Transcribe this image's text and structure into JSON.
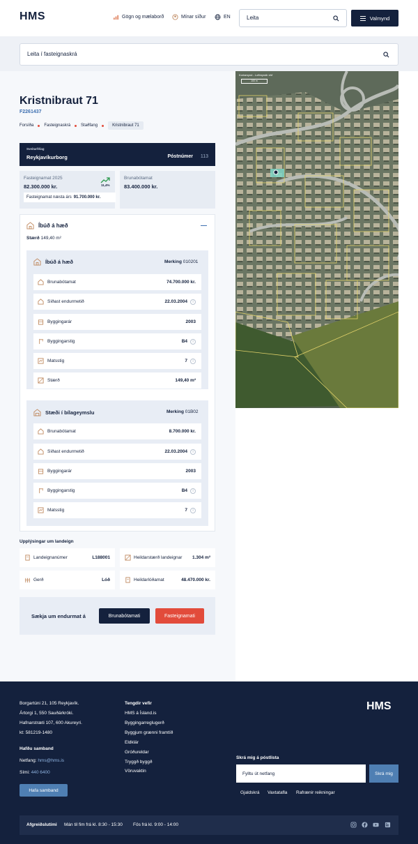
{
  "header": {
    "logo": "HMS",
    "nav": [
      {
        "label": "Gögn og mælaborð",
        "icon": "chart-icon"
      },
      {
        "label": "Mínar síður",
        "icon": "user-circle-icon"
      },
      {
        "label": "EN",
        "icon": "globe-icon"
      }
    ],
    "search_placeholder": "Leita",
    "menu_label": "Valmynd"
  },
  "registry_search": {
    "placeholder": "Leita í fasteignaskrá"
  },
  "property": {
    "title": "Kristnibraut 71",
    "id": "F2261437",
    "breadcrumbs": [
      "Forsíða",
      "Fasteignaskrá",
      "Staðfang",
      "Kristnibraut 71"
    ],
    "municipality_label": "Sveitarfélag",
    "municipality": "Reykjavíkurborg",
    "postcode_label": "Póstnúmer",
    "postcode": "113",
    "valuation": {
      "label": "Fasteignamat 2025",
      "value": "82.300.000 kr.",
      "change": "11,4%",
      "next_label": "Fasteignamat næsta árs",
      "next_value": "91.700.000 kr."
    },
    "fire_valuation": {
      "label": "Brunabótamat",
      "value": "83.400.000 kr."
    }
  },
  "unit": {
    "title": "Íbúð á hæð",
    "size_label": "Stærð",
    "size": "149,40 m²",
    "subunits": [
      {
        "title": "Íbúð á hæð",
        "mark_label": "Merking",
        "mark": "010201",
        "rows": [
          {
            "label": "Brunabótamat",
            "value": "74.700.000 kr.",
            "info": false
          },
          {
            "label": "Síðast endurmetið",
            "value": "22.03.2004",
            "info": true
          },
          {
            "label": "Byggingarár",
            "value": "2003",
            "info": false
          },
          {
            "label": "Byggingarstig",
            "value": "B4",
            "info": true
          },
          {
            "label": "Matsstig",
            "value": "7",
            "info": true
          },
          {
            "label": "Stærð",
            "value": "149,40 m²",
            "info": false
          }
        ]
      },
      {
        "title": "Stæði í bílageymslu",
        "mark_label": "Merking",
        "mark": "01B02",
        "rows": [
          {
            "label": "Brunabótamat",
            "value": "8.700.000 kr.",
            "info": false
          },
          {
            "label": "Síðast endurmetið",
            "value": "22.03.2004",
            "info": true
          },
          {
            "label": "Byggingarár",
            "value": "2003",
            "info": false
          },
          {
            "label": "Byggingarstig",
            "value": "B4",
            "info": true
          },
          {
            "label": "Matsstig",
            "value": "7",
            "info": true
          }
        ]
      }
    ]
  },
  "land": {
    "title": "Upplýsingar um landeign",
    "items": [
      {
        "label": "Landeignanúmer",
        "value": "L188001"
      },
      {
        "label": "Heildarstærð landeignar",
        "value": "1.304 m²"
      },
      {
        "label": "Gerð",
        "value": "Lóð"
      },
      {
        "label": "Heildarlóðamat",
        "value": "48.470.000 kr."
      }
    ]
  },
  "revaluation": {
    "label": "Sækja um endurmat á",
    "buttons": [
      "Brunabótamati",
      "Fasteignamati"
    ]
  },
  "map": {
    "source_label": "Kortamynd - Loftmyndir ehf",
    "scale": "100 m"
  },
  "footer": {
    "addresses": [
      "Borgartúni 21, 105 Reykjavík.",
      "Ártorgi 1, 550 Sauðárkróki.",
      "Hafnarstræti 107, 600 Akureyri.",
      "kt: 581219-1480"
    ],
    "contact_title": "Hafðu samband",
    "email_label": "Netfang:",
    "email": "hms@hms.is",
    "phone_label": "Sími:",
    "phone": "440 6400",
    "contact_button": "Hafa samband",
    "links_title": "Tengdir vefir",
    "links": [
      "HMS á Ísland.is",
      "Byggingarreglugerð",
      "Byggjum grænni framtíð",
      "Eldklár",
      "Gróðureldar",
      "Tryggð byggð",
      "Vöruvaktin"
    ],
    "logo": "HMS",
    "newsletter_title": "Skrá mig á póstlista",
    "newsletter_placeholder": "Fylltu út netfang",
    "newsletter_button": "Skrá mig",
    "legal_links": [
      "Gjaldskrá",
      "Vaxtatafla",
      "Rafrænir reikningar"
    ],
    "hours_title": "Afgreiðslutími",
    "hours": [
      "Mán til fim frá kl. 8:30 - 15:30",
      "Fös frá kl. 9:00 - 14:00"
    ],
    "social": [
      "instagram-icon",
      "facebook-icon",
      "youtube-icon",
      "linkedin-icon"
    ]
  },
  "colors": {
    "navy": "#14213d",
    "accent_red": "#e24b3b",
    "link_blue": "#3d6fb0",
    "panel": "#e8edf5"
  }
}
